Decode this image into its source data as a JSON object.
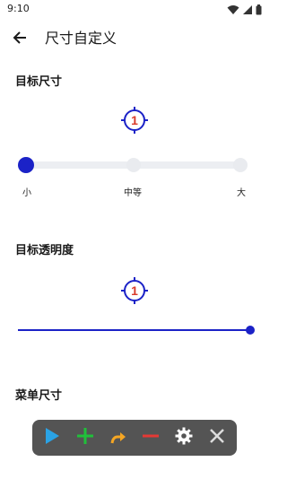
{
  "status_bar": {
    "time": "9:10",
    "icons": [
      "wifi-icon",
      "cellular-signal-icon",
      "battery-icon"
    ]
  },
  "app_bar": {
    "back_icon": "arrow-left-icon",
    "title": "尺寸自定义"
  },
  "target_size": {
    "title": "目标尺寸",
    "preview_number": "1",
    "labels": [
      "小",
      "中等",
      "大"
    ],
    "selected_index": 0
  },
  "target_opacity": {
    "title": "目标透明度",
    "preview_number": "1",
    "value_fraction": 1.0
  },
  "menu_size": {
    "title": "菜单尺寸"
  },
  "floating_toolbar": {
    "buttons": [
      "play-icon",
      "plus-icon",
      "swipe-arrow-icon",
      "minus-icon",
      "gear-icon",
      "close-icon"
    ]
  },
  "colors": {
    "accent": "#1b22c7",
    "target_number": "#d93a2a",
    "play": "#2aa3e6",
    "plus": "#20c03a",
    "swipe": "#f5a623",
    "minus": "#e53935",
    "toolbar_bg": "#545454"
  }
}
